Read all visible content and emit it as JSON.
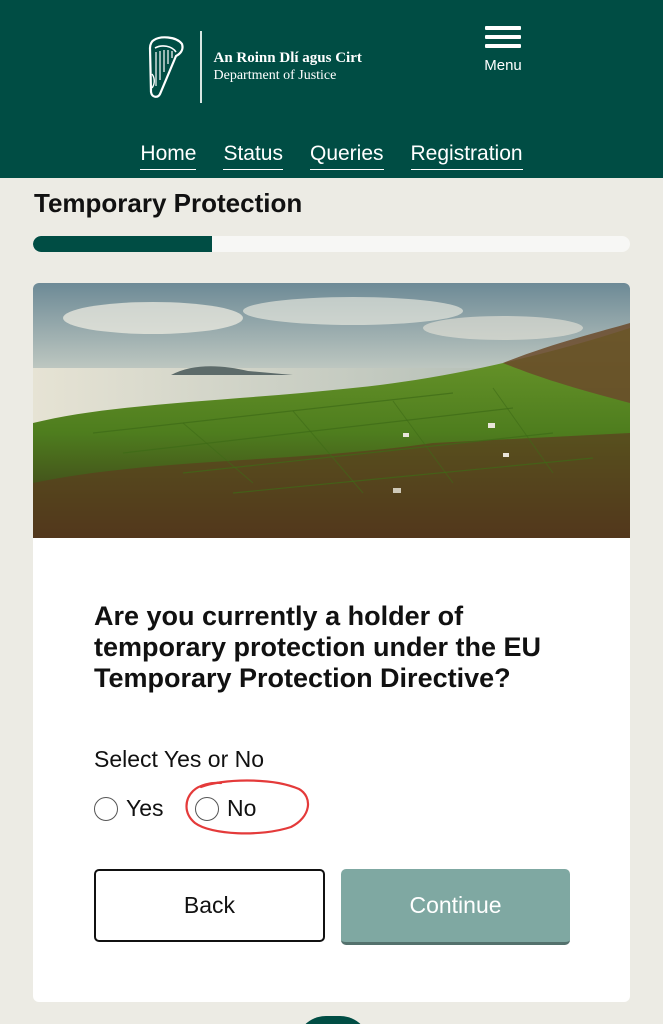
{
  "header": {
    "logo": {
      "irish_name": "An Roinn Dlí agus Cirt",
      "english_name": "Department of Justice",
      "emblem_icon": "harp-icon"
    },
    "menu": {
      "icon": "hamburger-icon",
      "label": "Menu"
    },
    "nav": [
      {
        "label": "Home"
      },
      {
        "label": "Status"
      },
      {
        "label": "Queries"
      },
      {
        "label": "Registration"
      }
    ]
  },
  "page": {
    "title": "Temporary Protection",
    "progress_fraction": 0.3
  },
  "question_card": {
    "image_icon": "landscape-photo",
    "question": "Are you currently a holder of temporary protection under the EU Temporary Protection Directive?",
    "instruction": "Select Yes or No",
    "options": [
      {
        "label": "Yes",
        "selected": false
      },
      {
        "label": "No",
        "selected": false
      }
    ],
    "back_label": "Back",
    "continue_label": "Continue"
  },
  "colors": {
    "brand": "#004d44",
    "continue_disabled": "#7fa8a2",
    "annotation_red": "#e43a3a",
    "page_bg": "#ecebe4"
  }
}
